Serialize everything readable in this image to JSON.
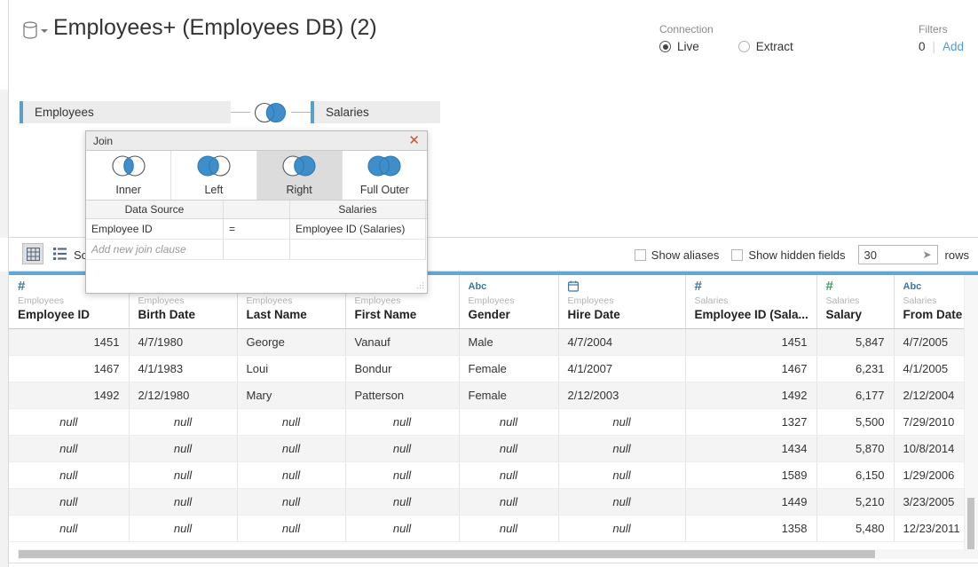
{
  "header": {
    "db_icon": "database-icon",
    "title": "Employees+ (Employees DB) (2)",
    "connection": {
      "label": "Connection",
      "options": [
        {
          "label": "Live",
          "selected": true
        },
        {
          "label": "Extract",
          "selected": false
        }
      ]
    },
    "filters": {
      "label": "Filters",
      "count": "0",
      "separator": "|",
      "add_label": "Add"
    }
  },
  "canvas": {
    "tables": [
      {
        "name": "Employees"
      },
      {
        "name": "Salaries"
      }
    ],
    "join_icon": "right-join-venn-icon"
  },
  "join_dialog": {
    "title": "Join",
    "close_icon": "close-icon",
    "types": [
      {
        "label": "Inner",
        "icon": "inner-join-venn-icon",
        "active": false
      },
      {
        "label": "Left",
        "icon": "left-join-venn-icon",
        "active": false
      },
      {
        "label": "Right",
        "icon": "right-join-venn-icon",
        "active": true
      },
      {
        "label": "Full Outer",
        "icon": "full-outer-join-venn-icon",
        "active": false
      }
    ],
    "columns": {
      "left_header": "Data Source",
      "mid_header": "",
      "right_header": "Salaries"
    },
    "clauses": [
      {
        "left": "Employee ID",
        "operator": "=",
        "right": "Employee ID (Salaries)"
      }
    ],
    "new_clause_placeholder": "Add new join clause"
  },
  "grid_toolbar": {
    "view_grid_icon": "grid-view-icon",
    "view_list_icon": "list-view-icon",
    "sort_label": "Sort",
    "show_aliases": {
      "label": "Show aliases",
      "checked": false
    },
    "show_hidden_fields": {
      "label": "Show hidden fields",
      "checked": false
    },
    "rows_value": "30",
    "rows_spinner_icon": "arrow-right-icon",
    "rows_label": "rows"
  },
  "chart_data": {
    "type": "table",
    "title": "Employees+ (Employees DB) (2)",
    "columns": [
      {
        "name": "Employee ID",
        "source": "Employees",
        "icon": "number-icon",
        "icon_color": "#3b78a5",
        "align": "num"
      },
      {
        "name": "Birth Date",
        "source": "Employees",
        "icon": "date-icon",
        "icon_color": "#3b78a5",
        "align": "txt"
      },
      {
        "name": "Last Name",
        "source": "Employees",
        "icon": "abc-icon",
        "icon_color": "#3b78a5",
        "align": "txt"
      },
      {
        "name": "First Name",
        "source": "Employees",
        "icon": "abc-icon",
        "icon_color": "#3b78a5",
        "align": "txt"
      },
      {
        "name": "Gender",
        "source": "Employees",
        "icon": "abc-icon",
        "icon_color": "#3b78a5",
        "align": "txt"
      },
      {
        "name": "Hire Date",
        "source": "Employees",
        "icon": "date-icon",
        "icon_color": "#3b78a5",
        "align": "txt"
      },
      {
        "name": "Employee ID (Sala...",
        "source": "Salaries",
        "icon": "number-icon",
        "icon_color": "#3b78a5",
        "align": "num"
      },
      {
        "name": "Salary",
        "source": "Salaries",
        "icon": "number-icon",
        "icon_color": "#39a06a",
        "align": "num"
      },
      {
        "name": "From Date",
        "source": "Salaries",
        "icon": "abc-icon",
        "icon_color": "#3b78a5",
        "align": "txt"
      }
    ],
    "null_text": "null",
    "rows": [
      [
        "1451",
        "4/7/1980",
        "George",
        "Vanauf",
        "Male",
        "4/7/2004",
        "1451",
        "5,847",
        "4/7/2005"
      ],
      [
        "1467",
        "4/1/1983",
        "Loui",
        "Bondur",
        "Female",
        "4/1/2007",
        "1467",
        "6,231",
        "4/1/2005"
      ],
      [
        "1492",
        "2/12/1980",
        "Mary",
        "Patterson",
        "Female",
        "2/12/2003",
        "1492",
        "6,177",
        "2/12/2004"
      ],
      [
        "null",
        "null",
        "null",
        "null",
        "null",
        "null",
        "1327",
        "5,500",
        "7/29/2010"
      ],
      [
        "null",
        "null",
        "null",
        "null",
        "null",
        "null",
        "1434",
        "5,870",
        "10/8/2014"
      ],
      [
        "null",
        "null",
        "null",
        "null",
        "null",
        "null",
        "1589",
        "6,150",
        "1/29/2006"
      ],
      [
        "null",
        "null",
        "null",
        "null",
        "null",
        "null",
        "1449",
        "5,210",
        "3/23/2005"
      ],
      [
        "null",
        "null",
        "null",
        "null",
        "null",
        "null",
        "1358",
        "5,480",
        "12/23/2011"
      ]
    ]
  },
  "colors": {
    "accent_blue": "#62a7d4",
    "venn_blue": "#3e8ecc",
    "link_blue": "#4e9bd1",
    "measure_green": "#39a06a",
    "dimension_blue": "#3b78a5"
  }
}
